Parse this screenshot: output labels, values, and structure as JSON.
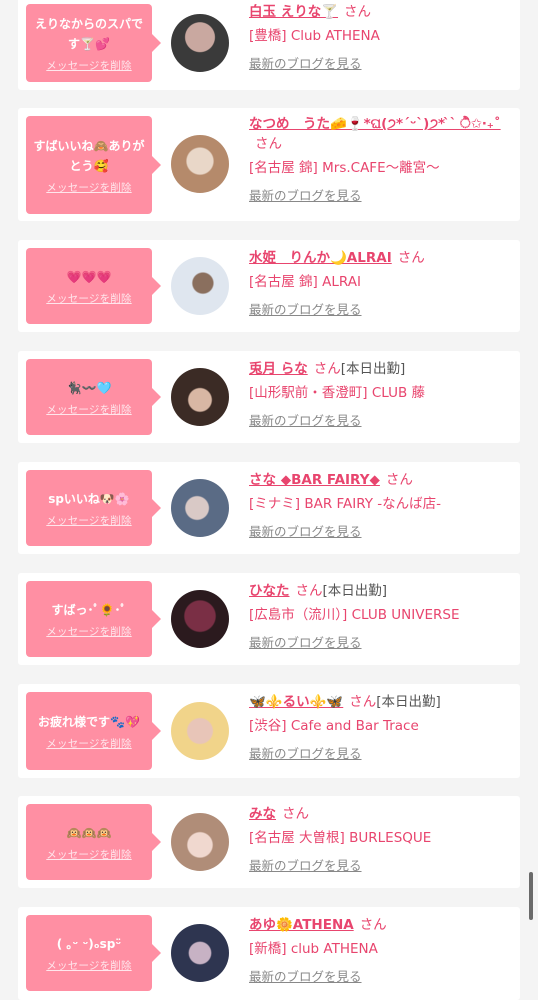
{
  "cards": [
    {
      "message": "えりなからのスパです🍸💕",
      "delete_label": "メッセージを削除",
      "name": "白玉 えりな🍸",
      "honorific": "さん",
      "status": "",
      "shop": "[豊橋] Club ATHENA",
      "blog_link": "最新のブログを見る",
      "avatar_colors": [
        "#3a3a3a",
        "#c9a8a0"
      ]
    },
    {
      "message": "すばいいね🙈ありがとう🥰",
      "delete_label": "メッセージを削除",
      "name": "なつめ　うた🧀🍷*ଘ(੭*ˊᵕˋ)੭* ̀ˋ ੈ✩‧₊˚",
      "honorific": "さん",
      "status": "",
      "shop": "[名古屋 錦] Mrs.CAFE～離宮～",
      "blog_link": "最新のブログを見る",
      "avatar_colors": [
        "#e9d7c8",
        "#b58a6b"
      ]
    },
    {
      "message": "💗💗💗",
      "delete_label": "メッセージを削除",
      "name": "水姫　りんか🌙ALRAI",
      "honorific": "さん",
      "status": "",
      "shop": "[名古屋 錦] ALRAI",
      "blog_link": "最新のブログを見る",
      "avatar_colors": [
        "#dfe6ef",
        "#8a6f5e"
      ]
    },
    {
      "message": "🐈‍⬛〰️🩵",
      "delete_label": "メッセージを削除",
      "name": "兎月 らな",
      "honorific": "さん",
      "status": "[本日出勤]",
      "shop": "[山形駅前・香澄町] CLUB 藤",
      "blog_link": "最新のブログを見る",
      "avatar_colors": [
        "#3b2b25",
        "#d8b7a4"
      ]
    },
    {
      "message": "spいいね🐶🌸",
      "delete_label": "メッセージを削除",
      "name": "さな ◆BAR FAIRY◆",
      "honorific": "さん",
      "status": "",
      "shop": "[ミナミ] BAR FAIRY -なんば店-",
      "blog_link": "最新のブログを見る",
      "avatar_colors": [
        "#5a6b85",
        "#d9c9c6"
      ]
    },
    {
      "message": "すばっ･ﾟ🌻･ﾟ",
      "delete_label": "メッセージを削除",
      "name": "ひなた",
      "honorific": "さん",
      "status": "[本日出勤]",
      "shop": "[広島市（流川）] CLUB UNIVERSE",
      "blog_link": "最新のブログを見る",
      "avatar_colors": [
        "#7a2f45",
        "#2b1a1e"
      ]
    },
    {
      "message": "お疲れ様です🐾💖",
      "delete_label": "メッセージを削除",
      "name": "🦋⚜️るい⚜️🦋",
      "honorific": "さん",
      "status": "[本日出勤]",
      "shop": "[渋谷] Cafe and Bar Trace",
      "blog_link": "最新のブログを見る",
      "avatar_colors": [
        "#f1d48a",
        "#e8c5b8"
      ]
    },
    {
      "message": "🙉🙉🙉",
      "delete_label": "メッセージを削除",
      "name": "みな",
      "honorific": "さん",
      "status": "",
      "shop": "[名古屋 大曽根] BURLESQUE",
      "blog_link": "最新のブログを見る",
      "avatar_colors": [
        "#b08d78",
        "#f0d8cf"
      ]
    },
    {
      "message": "( ｡ᵕ ᵕ)ₒspᵕ̈",
      "delete_label": "メッセージを削除",
      "name": "あゆ🌼ATHENA",
      "honorific": "さん",
      "status": "",
      "shop": "[新橋] club ATHENA",
      "blog_link": "最新のブログを見る",
      "avatar_colors": [
        "#2e3550",
        "#c7b2c4"
      ]
    }
  ]
}
